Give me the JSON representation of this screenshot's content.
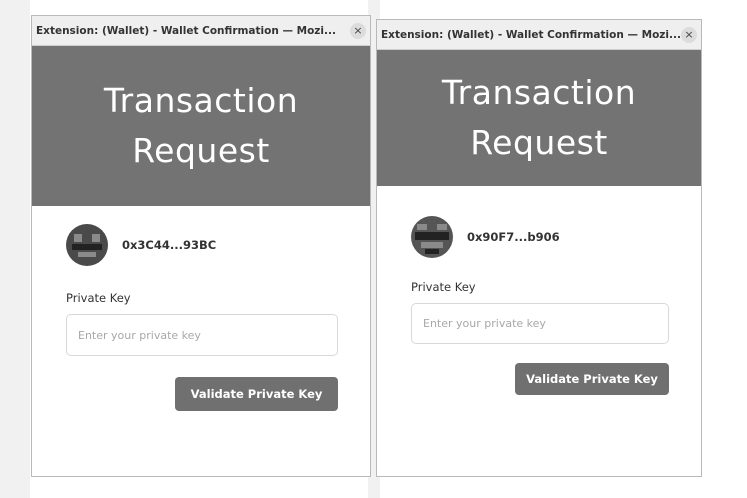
{
  "windows": [
    {
      "title": "Extension: (Wallet) - Wallet Confirmation — Mozi...",
      "close_glyph": "×",
      "header_title": "Transaction Request",
      "address": "0x3C44...93BC",
      "private_key_label": "Private Key",
      "private_key_placeholder": "Enter your private key",
      "private_key_value": "",
      "validate_label": "Validate Private Key"
    },
    {
      "title": "Extension: (Wallet) - Wallet Confirmation — Mozi...",
      "close_glyph": "×",
      "header_title": "Transaction Request",
      "address": "0x90F7...b906",
      "private_key_label": "Private Key",
      "private_key_placeholder": "Enter your private key",
      "private_key_value": "",
      "validate_label": "Validate Private Key"
    }
  ],
  "colors": {
    "header_bg": "#737373",
    "button_bg": "#707070",
    "titlebar_bg": "#efefef"
  },
  "icons": {
    "close": "close-icon",
    "avatar": "avatar-identicon"
  }
}
